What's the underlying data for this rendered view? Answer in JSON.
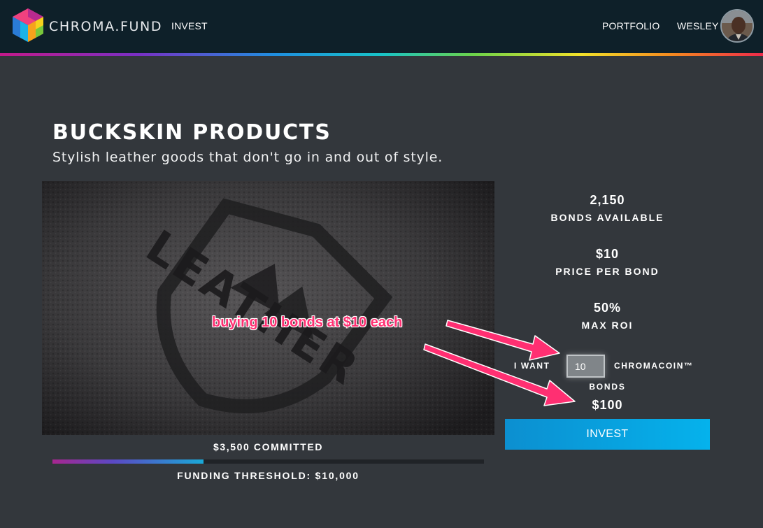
{
  "header": {
    "brand": "CHROMA.FUND",
    "nav_invest": "INVEST",
    "nav_portfolio": "PORTFOLIO",
    "user_name": "WESLEY"
  },
  "project": {
    "title": "BUCKSKIN PRODUCTS",
    "subtitle": "Stylish leather goods that don't go in and out of style.",
    "image_text": "LEATHER"
  },
  "funding": {
    "committed": "$3,500 COMMITTED",
    "threshold": "FUNDING THRESHOLD: $10,000",
    "progress_fraction": 0.35
  },
  "stats": {
    "bonds_available_value": "2,150",
    "bonds_available_label": "BONDS AVAILABLE",
    "price_value": "$10",
    "price_label": "PRICE PER BOND",
    "roi_value": "50%",
    "roi_label": "MAX ROI"
  },
  "purchase": {
    "want_label": "I WANT",
    "quantity": "10",
    "coin_label": "CHROMACOIN™",
    "bonds_label": "BONDS",
    "total": "$100",
    "invest_label": "INVEST"
  },
  "annotation": {
    "text": "buying 10 bonds at $10 each"
  },
  "colors": {
    "background": "#33373c",
    "header": "#0e2029",
    "accent": "#05b2ec",
    "annotation": "#ff2f72"
  }
}
